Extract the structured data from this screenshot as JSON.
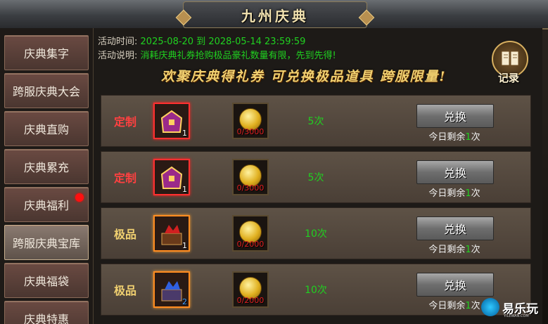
{
  "window": {
    "title": "九州庆典"
  },
  "sidebar": {
    "items": [
      {
        "label": "庆典集字"
      },
      {
        "label": "跨服庆典大会"
      },
      {
        "label": "庆典直购"
      },
      {
        "label": "庆典累充"
      },
      {
        "label": "庆典福利",
        "badge": "red-dot"
      },
      {
        "label": "跨服庆典宝库",
        "active": true
      },
      {
        "label": "庆典福袋"
      },
      {
        "label": "庆典特惠"
      }
    ]
  },
  "activity": {
    "time_label": "活动时间:",
    "time_value": "2025-08-20 到 2028-05-14 23:59:59",
    "desc_label": "活动说明:",
    "desc_value": "消耗庆典礼券抢购极品豪礼数量有限，先到先得!",
    "banner": "欢聚庆典得礼券 可兑换极品道具 跨服限量!",
    "record_label": "记录"
  },
  "rows": [
    {
      "tag": "定制",
      "tag_color": "#ff4040",
      "item_count": "1",
      "item_icon": "purple-chest-icon",
      "cost": "0/3000",
      "times": "5次",
      "button": "兑换",
      "remain_prefix": "今日剩余",
      "remain_num": "1",
      "remain_suffix": "次"
    },
    {
      "tag": "定制",
      "tag_color": "#ff4040",
      "item_count": "1",
      "item_icon": "purple-chest-icon",
      "cost": "0/3000",
      "times": "5次",
      "button": "兑换",
      "remain_prefix": "今日剩余",
      "remain_num": "1",
      "remain_suffix": "次"
    },
    {
      "tag": "极品",
      "tag_color": "#f0d070",
      "item_count": "1",
      "item_icon": "red-gem-chest-icon",
      "cost": "0/2000",
      "times": "10次",
      "button": "兑换",
      "remain_prefix": "今日剩余",
      "remain_num": "1",
      "remain_suffix": "次"
    },
    {
      "tag": "极品",
      "tag_color": "#f0d070",
      "item_count": "2",
      "item_icon": "blue-gem-chest-icon",
      "cost": "0/2000",
      "times": "10次",
      "button": "兑换",
      "remain_prefix": "今日剩余",
      "remain_num": "1",
      "remain_suffix": "次"
    }
  ],
  "watermark": {
    "text": "易乐玩",
    "sub": "YILEWAN.COM"
  },
  "colors": {
    "accent_green": "#20d020",
    "cost_red": "#e02020",
    "gold": "#f0d070"
  }
}
